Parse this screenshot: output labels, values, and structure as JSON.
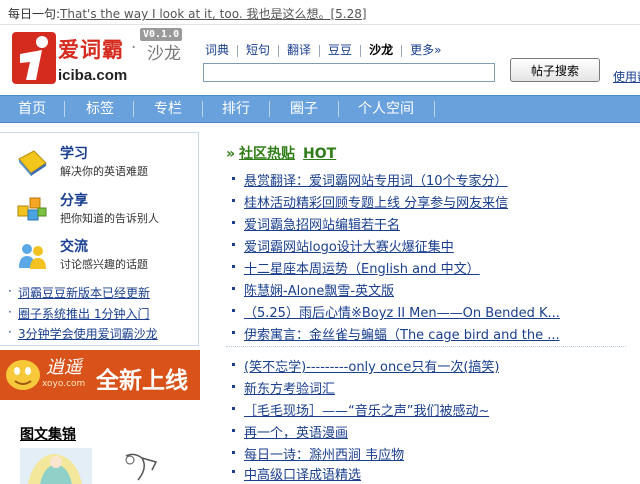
{
  "top_strip": {
    "daily_label": "每日一句:",
    "daily_sentence": "That's the way I look at it, too. 我也是这么想。[5.28]"
  },
  "logo": {
    "main_text": "爱词霸",
    "dot": "·",
    "sub_text": "沙龙",
    "domain": "iciba.com",
    "version": "V0.1.0"
  },
  "top_nav": [
    "词典",
    "短句",
    "翻译",
    "豆豆",
    "沙龙",
    "更多»"
  ],
  "search": {
    "input_value": "",
    "button_label": "帖子搜索",
    "help_link": "使用帮"
  },
  "main_nav": [
    "首页",
    "标签",
    "专栏",
    "排行",
    "圈子",
    "个人空间"
  ],
  "categories": [
    {
      "title": "学习",
      "subtitle": "解决你的英语难题",
      "icon": "book-icon"
    },
    {
      "title": "分享",
      "subtitle": "把你知道的告诉别人",
      "icon": "blocks-icon"
    },
    {
      "title": "交流",
      "subtitle": "讨论感兴趣的话题",
      "icon": "people-icon"
    }
  ],
  "news_links": [
    "词霸豆豆新版本已经更新",
    "圈子系统推出 1分钟入门",
    "3分钟学会使用爱词霸沙龙"
  ],
  "banner": {
    "brand": "逍遥",
    "url": "xoyo.com",
    "text": "全新上线"
  },
  "gallery_title": "图文集锦",
  "hot": {
    "arrow": "»",
    "title": "社区热贴",
    "badge": "HOT",
    "items_group1": [
      "悬赏翻译：爱词霸网站专用词（10个专家分）",
      "桂林活动精彩回顾专题上线 分享参与网友来信",
      "爱词霸急招网站编辑若干名",
      "爱词霸网站logo设计大赛火爆征集中",
      "十二星座本周运势（English and 中文）",
      "陈慧娴-Alone飘雪-英文版",
      "（5.25）雨后心情※Boyz II Men——On Bended K...",
      "伊索寓言：金丝雀与蝙蝠（The cage bird and the ..."
    ],
    "items_group2": [
      "(笑不忘学)---------only once只有一次(搞笑)",
      "新东方考验词汇",
      "［毛毛现场］——“音乐之声”我们被感动~",
      "再一个，英语漫画",
      "每日一诗：滁州西涧 韦应物",
      "中高级口译成语精选"
    ]
  },
  "colors": {
    "nav_bar": "#69a1dc",
    "link_blue": "#1a3f8f",
    "hot_green": "#2e7d16",
    "brand_red": "#d52b1e",
    "banner_orange": "#d9521a"
  }
}
